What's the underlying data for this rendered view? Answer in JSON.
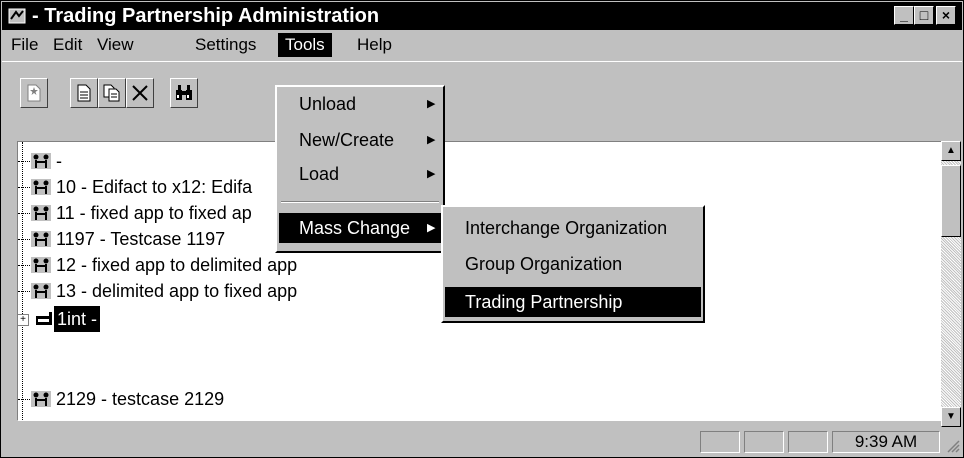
{
  "window": {
    "title": "- Trading Partnership Administration",
    "controls": {
      "minimize": "_",
      "maximize": "□",
      "close": "×"
    }
  },
  "menubar": {
    "items": [
      {
        "label": "File",
        "mnemonic": "F"
      },
      {
        "label": "Edit",
        "mnemonic": "E"
      },
      {
        "label": "View",
        "mnemonic": "V"
      },
      {
        "label": "Settings",
        "mnemonic": "S"
      },
      {
        "label": "Tools",
        "mnemonic": "T",
        "active": true
      },
      {
        "label": "Help",
        "mnemonic": "H"
      }
    ]
  },
  "toolbar": {
    "buttons": [
      {
        "icon": "new-document-icon"
      },
      {
        "icon": "properties-icon"
      },
      {
        "icon": "copy-icon"
      },
      {
        "icon": "delete-icon"
      },
      {
        "icon": "find-binoculars-icon"
      }
    ]
  },
  "tools_menu": {
    "items": [
      {
        "label": "Unload",
        "has_submenu": true
      },
      {
        "label": "New/Create",
        "has_submenu": true
      },
      {
        "label": "Load",
        "has_submenu": true
      },
      {
        "label": "Mass Change",
        "has_submenu": true,
        "highlighted": true
      }
    ]
  },
  "mass_change_menu": {
    "items": [
      {
        "label": "Interchange Organization"
      },
      {
        "label": "Group Organization"
      },
      {
        "label": "Trading Partnership",
        "highlighted": true
      }
    ]
  },
  "tree": {
    "items": [
      {
        "label": "-",
        "icon": "partnership-icon"
      },
      {
        "label": "10 - Edifact to x12: Edifa",
        "icon": "partnership-icon"
      },
      {
        "label": "11 - fixed app to fixed ap",
        "icon": "partnership-icon"
      },
      {
        "label": "1197 - Testcase 1197",
        "icon": "partnership-icon"
      },
      {
        "label": "12 - fixed app to delimited app",
        "icon": "partnership-icon"
      },
      {
        "label": "13 - delimited app to fixed app",
        "icon": "partnership-icon"
      },
      {
        "label": "1int -",
        "icon": "interchange-icon",
        "expandable": true,
        "selected": true
      },
      {
        "label": "2129 - testcase 2129",
        "icon": "partnership-icon"
      }
    ],
    "expander": "+"
  },
  "statusbar": {
    "time": "9:39 AM"
  }
}
